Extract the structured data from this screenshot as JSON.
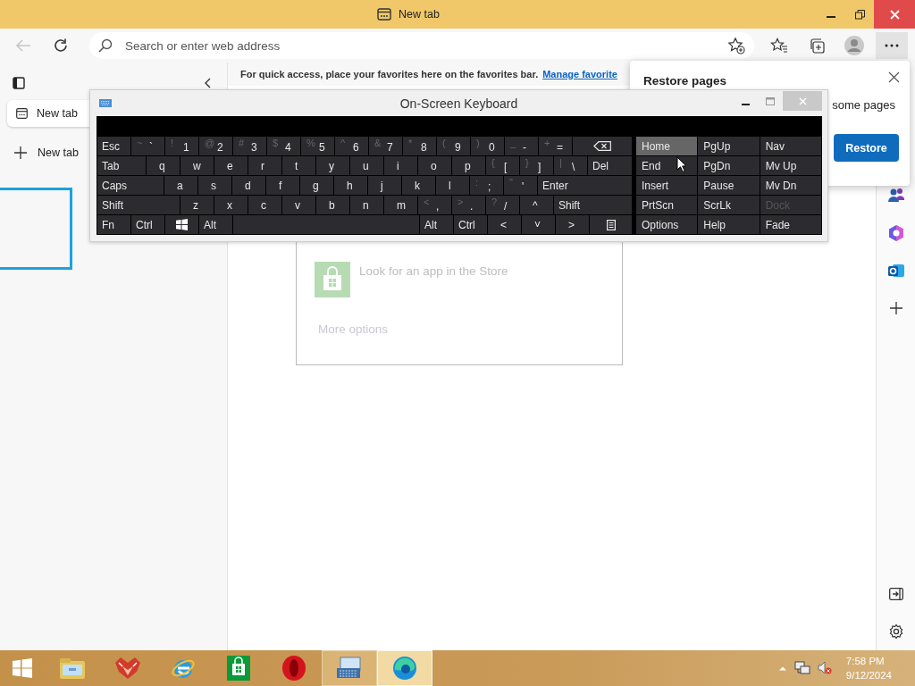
{
  "window": {
    "title": "New tab"
  },
  "toolbar": {
    "address_placeholder": "Search or enter web address"
  },
  "sidebar": {
    "tabs": [
      {
        "label": "New tab",
        "selected": true
      }
    ],
    "new_tab_label": "New tab"
  },
  "favorites_bar": {
    "message": "For quick access, place your favorites here on the favorites bar.",
    "link": "Manage favorite"
  },
  "restore_popup": {
    "title": "Restore pages",
    "text": "some pages",
    "button": "Restore"
  },
  "app_picker": {
    "store_text": "Look for an app in the Store",
    "more_options": "More options"
  },
  "osk": {
    "title": "On-Screen Keyboard",
    "rows": [
      [
        {
          "kind": "text",
          "label": "Esc"
        },
        {
          "kind": "pair",
          "shift": "~",
          "label": "`"
        },
        {
          "kind": "pair",
          "shift": "!",
          "label": "1"
        },
        {
          "kind": "pair",
          "shift": "@",
          "label": "2"
        },
        {
          "kind": "pair",
          "shift": "#",
          "label": "3"
        },
        {
          "kind": "pair",
          "shift": "$",
          "label": "4"
        },
        {
          "kind": "pair",
          "shift": "%",
          "label": "5"
        },
        {
          "kind": "pair",
          "shift": "^",
          "label": "6"
        },
        {
          "kind": "pair",
          "shift": "&",
          "label": "7"
        },
        {
          "kind": "pair",
          "shift": "*",
          "label": "8"
        },
        {
          "kind": "pair",
          "shift": "(",
          "label": "9"
        },
        {
          "kind": "pair",
          "shift": ")",
          "label": "0"
        },
        {
          "kind": "pair",
          "shift": "_",
          "label": "-"
        },
        {
          "kind": "pair",
          "shift": "+",
          "label": "="
        },
        {
          "kind": "backspace"
        }
      ],
      [
        {
          "kind": "text",
          "label": "Tab"
        },
        {
          "kind": "char",
          "label": "q"
        },
        {
          "kind": "char",
          "label": "w"
        },
        {
          "kind": "char",
          "label": "e"
        },
        {
          "kind": "char",
          "label": "r"
        },
        {
          "kind": "char",
          "label": "t"
        },
        {
          "kind": "char",
          "label": "y"
        },
        {
          "kind": "char",
          "label": "u"
        },
        {
          "kind": "char",
          "label": "i"
        },
        {
          "kind": "char",
          "label": "o"
        },
        {
          "kind": "char",
          "label": "p"
        },
        {
          "kind": "pair",
          "shift": "{",
          "label": "["
        },
        {
          "kind": "pair",
          "shift": "}",
          "label": "]"
        },
        {
          "kind": "pair",
          "shift": "|",
          "label": "\\"
        },
        {
          "kind": "text",
          "label": "Del"
        }
      ],
      [
        {
          "kind": "text",
          "label": "Caps"
        },
        {
          "kind": "char",
          "label": "a"
        },
        {
          "kind": "char",
          "label": "s"
        },
        {
          "kind": "char",
          "label": "d"
        },
        {
          "kind": "char",
          "label": "f"
        },
        {
          "kind": "char",
          "label": "g"
        },
        {
          "kind": "char",
          "label": "h"
        },
        {
          "kind": "char",
          "label": "j"
        },
        {
          "kind": "char",
          "label": "k"
        },
        {
          "kind": "char",
          "label": "l"
        },
        {
          "kind": "pair",
          "shift": ":",
          "label": ";"
        },
        {
          "kind": "pair",
          "shift": "\"",
          "label": "'"
        },
        {
          "kind": "text",
          "label": "Enter"
        }
      ],
      [
        {
          "kind": "text",
          "label": "Shift"
        },
        {
          "kind": "char",
          "label": "z"
        },
        {
          "kind": "char",
          "label": "x"
        },
        {
          "kind": "char",
          "label": "c"
        },
        {
          "kind": "char",
          "label": "v"
        },
        {
          "kind": "char",
          "label": "b"
        },
        {
          "kind": "char",
          "label": "n"
        },
        {
          "kind": "char",
          "label": "m"
        },
        {
          "kind": "pair",
          "shift": "<",
          "label": ","
        },
        {
          "kind": "pair",
          "shift": ">",
          "label": "."
        },
        {
          "kind": "pair",
          "shift": "?",
          "label": "/"
        },
        {
          "kind": "char",
          "label": "^"
        },
        {
          "kind": "text",
          "label": "Shift"
        }
      ],
      [
        {
          "kind": "text",
          "label": "Fn"
        },
        {
          "kind": "text",
          "label": "Ctrl"
        },
        {
          "kind": "windows"
        },
        {
          "kind": "text",
          "label": "Alt"
        },
        {
          "kind": "space"
        },
        {
          "kind": "text",
          "label": "Alt"
        },
        {
          "kind": "text",
          "label": "Ctrl"
        },
        {
          "kind": "char",
          "label": "<"
        },
        {
          "kind": "char",
          "label": "˅"
        },
        {
          "kind": "char",
          "label": ">"
        },
        {
          "kind": "menu"
        }
      ]
    ],
    "side_keys": [
      {
        "label": "Home",
        "highlighted": true,
        "disabled": false
      },
      {
        "label": "PgUp",
        "highlighted": false,
        "disabled": false
      },
      {
        "label": "Nav",
        "highlighted": false,
        "disabled": false
      },
      {
        "label": "End",
        "highlighted": false,
        "disabled": false
      },
      {
        "label": "PgDn",
        "highlighted": false,
        "disabled": false
      },
      {
        "label": "Mv Up",
        "highlighted": false,
        "disabled": false
      },
      {
        "label": "Insert",
        "highlighted": false,
        "disabled": false
      },
      {
        "label": "Pause",
        "highlighted": false,
        "disabled": false
      },
      {
        "label": "Mv Dn",
        "highlighted": false,
        "disabled": false
      },
      {
        "label": "PrtScn",
        "highlighted": false,
        "disabled": false
      },
      {
        "label": "ScrLk",
        "highlighted": false,
        "disabled": false
      },
      {
        "label": "Dock",
        "highlighted": false,
        "disabled": true
      },
      {
        "label": "Options",
        "highlighted": false,
        "disabled": false
      },
      {
        "label": "Help",
        "highlighted": false,
        "disabled": false
      },
      {
        "label": "Fade",
        "highlighted": false,
        "disabled": false
      }
    ]
  },
  "taskbar": {
    "apps": [
      {
        "kind": "start",
        "open": false,
        "focused": false
      },
      {
        "kind": "explorer",
        "open": false,
        "focused": false
      },
      {
        "kind": "fox",
        "open": false,
        "focused": false
      },
      {
        "kind": "ie",
        "open": false,
        "focused": false
      },
      {
        "kind": "store",
        "open": false,
        "focused": false
      },
      {
        "kind": "opera",
        "open": false,
        "focused": false
      },
      {
        "kind": "keyboard",
        "open": true,
        "focused": false
      },
      {
        "kind": "edge",
        "open": true,
        "focused": true
      }
    ],
    "clock": {
      "time": "7:58 PM",
      "date": "9/12/2024"
    }
  }
}
